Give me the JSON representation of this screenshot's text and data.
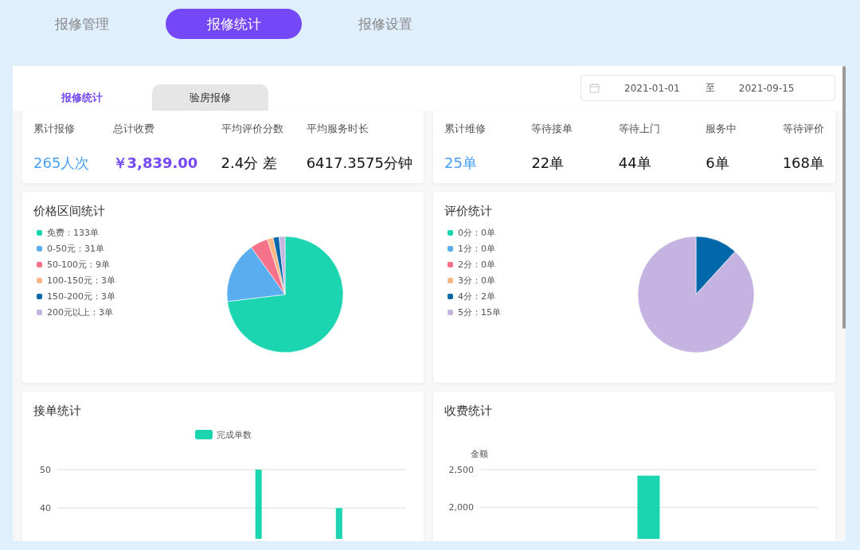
{
  "nav_tabs": [
    {
      "label": "报修管理",
      "selected": false
    },
    {
      "label": "报修统计",
      "selected": true
    },
    {
      "label": "报修设置",
      "selected": false
    }
  ],
  "sub_tabs": [
    {
      "label": "报修统计",
      "selected": true
    },
    {
      "label": "验房报修",
      "selected": false
    }
  ],
  "date_range": {
    "start": "2021-01-01",
    "separator": "至",
    "end": "2021-09-15"
  },
  "repair_stats": [
    {
      "label": "累计报修",
      "value": "265人次",
      "kind": "highlight"
    },
    {
      "label": "总计收费",
      "value": "￥3,839.00",
      "kind": "money"
    },
    {
      "label": "平均评价分数",
      "value": "2.4分 差",
      "kind": "plain"
    },
    {
      "label": "平均服务时长",
      "value": "6417.3575分钟",
      "kind": "plain"
    }
  ],
  "maintenance_stats": [
    {
      "label": "累计维修",
      "value": "25单",
      "kind": "highlight"
    },
    {
      "label": "等待接单",
      "value": "22单",
      "kind": "plain"
    },
    {
      "label": "等待上门",
      "value": "44单",
      "kind": "plain"
    },
    {
      "label": "服务中",
      "value": "6单",
      "kind": "plain"
    },
    {
      "label": "等待评价",
      "value": "168单",
      "kind": "plain"
    }
  ],
  "charts": [
    {
      "chart_data": {
        "type": "pie",
        "title": "价格区间统计",
        "categories": [
          "免费：133单",
          "0-50元：31单",
          "50-100元：9单",
          "100-150元：3单",
          "150-200元：3单",
          "200元以上：3单"
        ],
        "values": [
          133,
          31,
          9,
          3,
          3,
          3
        ],
        "colors": [
          "#1bd4b0",
          "#5aaef0",
          "#f6728a",
          "#fdb784",
          "#0068a8",
          "#c5b3e2"
        ]
      }
    },
    {
      "chart_data": {
        "type": "pie",
        "title": "评价统计",
        "categories": [
          "0分：0单",
          "1分：0单",
          "2分：0单",
          "3分：0单",
          "4分：2单",
          "5分：15单"
        ],
        "values": [
          0,
          0,
          0,
          0,
          2,
          15
        ],
        "colors": [
          "#1bd4b0",
          "#5aaef0",
          "#f6728a",
          "#fdb784",
          "#0068a8",
          "#c5b3e2"
        ]
      }
    },
    {
      "chart_data": {
        "type": "bar",
        "title": "接单统计",
        "series": [
          {
            "name": "完成单数",
            "color": "#1bd4b0",
            "values": [
              null,
              null,
              null,
              null,
              null,
              null,
              null,
              50,
              null,
              null,
              40,
              null,
              null
            ]
          }
        ],
        "yticks": [
          40,
          50
        ],
        "ylim": [
          32,
          50
        ],
        "legend": true
      }
    },
    {
      "chart_data": {
        "type": "bar",
        "title": "收费统计",
        "ylabel": "金额",
        "series": [
          {
            "color": "#1bd4b0",
            "values": [
              2420
            ]
          }
        ],
        "yticks": [
          {
            "value": 2000,
            "label": "2,000"
          },
          {
            "value": 2500,
            "label": "2,500"
          }
        ],
        "ylim": [
          1580,
          2500
        ],
        "legend": false
      }
    }
  ]
}
